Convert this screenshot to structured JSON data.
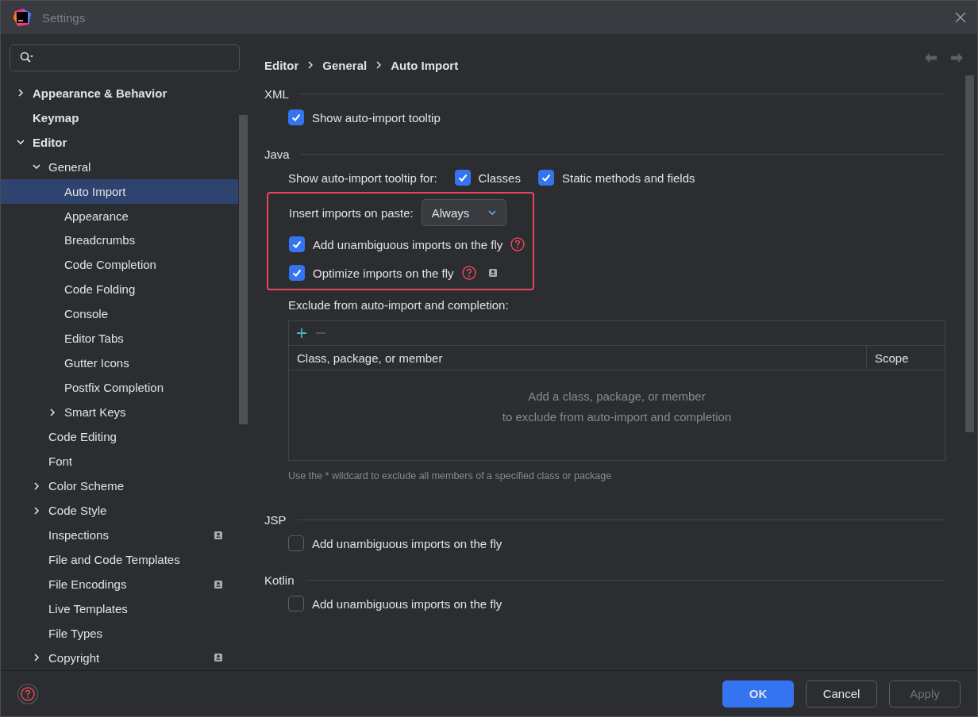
{
  "window": {
    "title": "Settings"
  },
  "sidebar": {
    "items": [
      {
        "label": "Appearance & Behavior",
        "expanded": false,
        "selected": false
      },
      {
        "label": "Keymap",
        "selected": false
      },
      {
        "label": "Editor",
        "expanded": true,
        "selected": false,
        "children": [
          {
            "label": "General",
            "expanded": true,
            "selected": false,
            "children": [
              {
                "label": "Auto Import",
                "selected": true
              },
              {
                "label": "Appearance",
                "selected": false
              },
              {
                "label": "Breadcrumbs",
                "selected": false
              },
              {
                "label": "Code Completion",
                "selected": false
              },
              {
                "label": "Code Folding",
                "selected": false
              },
              {
                "label": "Console",
                "selected": false
              },
              {
                "label": "Editor Tabs",
                "selected": false
              },
              {
                "label": "Gutter Icons",
                "selected": false
              },
              {
                "label": "Postfix Completion",
                "selected": false
              },
              {
                "label": "Smart Keys",
                "expanded": false,
                "selected": false
              }
            ]
          },
          {
            "label": "Code Editing",
            "selected": false
          },
          {
            "label": "Font",
            "selected": false
          },
          {
            "label": "Color Scheme",
            "expanded": false,
            "selected": false
          },
          {
            "label": "Code Style",
            "expanded": false,
            "selected": false
          },
          {
            "label": "Inspections",
            "selected": false,
            "project_level": true
          },
          {
            "label": "File and Code Templates",
            "selected": false
          },
          {
            "label": "File Encodings",
            "selected": false,
            "project_level": true
          },
          {
            "label": "Live Templates",
            "selected": false
          },
          {
            "label": "File Types",
            "selected": false
          },
          {
            "label": "Copyright",
            "expanded": false,
            "selected": false,
            "project_level": true
          }
        ]
      }
    ]
  },
  "breadcrumb": [
    "Editor",
    "General",
    "Auto Import"
  ],
  "sections": [
    {
      "title": "XML",
      "rows": [
        {
          "kind": "checkbox",
          "label": "Show auto-import tooltip",
          "checked": true
        }
      ]
    },
    {
      "title": "Java",
      "rows": [
        {
          "kind": "checkbox_group",
          "label": "Show auto-import tooltip for:",
          "options": [
            {
              "label": "Classes",
              "checked": true
            },
            {
              "label": "Static methods and fields",
              "checked": true
            }
          ]
        },
        {
          "kind": "highlight",
          "rows": [
            {
              "kind": "dropdown",
              "label": "Insert imports on paste:",
              "value": "Always"
            },
            {
              "kind": "checkbox",
              "label": "Add unambiguous imports on the fly",
              "checked": true,
              "help": true
            },
            {
              "kind": "checkbox",
              "label": "Optimize imports on the fly",
              "checked": true,
              "help": true,
              "project_level": true
            }
          ]
        },
        {
          "kind": "table",
          "label": "Exclude from auto-import and completion:",
          "remove_disabled": true,
          "columns": [
            "Class, package, or member",
            "Scope"
          ],
          "empty_text": [
            "Add a class, package, or member",
            "to exclude from auto-import and completion"
          ],
          "hint": "Use the * wildcard to exclude all members of a specified class or package"
        }
      ]
    },
    {
      "title": "JSP",
      "rows": [
        {
          "kind": "checkbox",
          "label": "Add unambiguous imports on the fly",
          "checked": false
        }
      ]
    },
    {
      "title": "Kotlin",
      "rows": [
        {
          "kind": "checkbox",
          "label": "Add unambiguous imports on the fly",
          "checked": false
        }
      ]
    }
  ],
  "buttons": [
    {
      "label": "OK",
      "kind": "primary",
      "disabled": false
    },
    {
      "label": "Cancel",
      "kind": "normal",
      "disabled": false
    },
    {
      "label": "Apply",
      "kind": "normal",
      "disabled": true
    }
  ]
}
